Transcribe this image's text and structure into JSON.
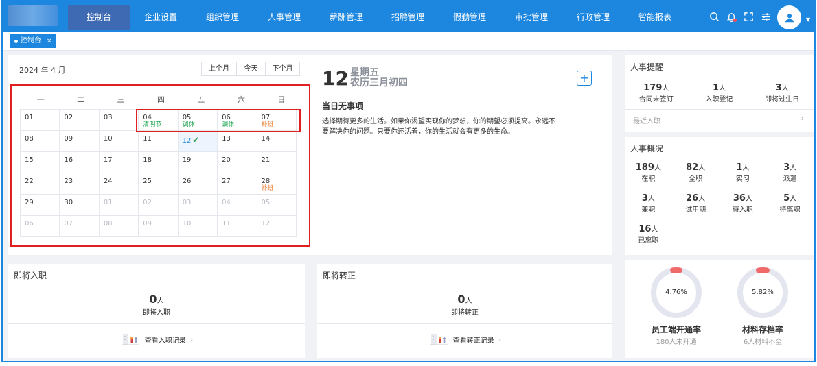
{
  "nav": {
    "items": [
      "控制台",
      "企业设置",
      "组织管理",
      "人事管理",
      "薪酬管理",
      "招聘管理",
      "假勤管理",
      "审批管理",
      "行政管理",
      "智能报表"
    ],
    "active_index": 0
  },
  "tabs": [
    {
      "label": "控制台",
      "close": "×"
    }
  ],
  "calendar": {
    "month_label": "2024 年 4 月",
    "buttons": [
      "上个月",
      "今天",
      "下个月"
    ],
    "weekdays": [
      "一",
      "二",
      "三",
      "四",
      "五",
      "六",
      "日"
    ],
    "weeks": [
      [
        {
          "d": "01"
        },
        {
          "d": "02"
        },
        {
          "d": "03"
        },
        {
          "d": "04",
          "sub": "清明节",
          "c": "green"
        },
        {
          "d": "05",
          "sub": "调休",
          "c": "green"
        },
        {
          "d": "06",
          "sub": "调休",
          "c": "green"
        },
        {
          "d": "07",
          "sub": "补班",
          "c": "orange"
        }
      ],
      [
        {
          "d": "08"
        },
        {
          "d": "09"
        },
        {
          "d": "10"
        },
        {
          "d": "11"
        },
        {
          "d": "12",
          "today": true
        },
        {
          "d": "13"
        },
        {
          "d": "14"
        }
      ],
      [
        {
          "d": "15"
        },
        {
          "d": "16"
        },
        {
          "d": "17"
        },
        {
          "d": "18"
        },
        {
          "d": "19"
        },
        {
          "d": "20"
        },
        {
          "d": "21"
        }
      ],
      [
        {
          "d": "22"
        },
        {
          "d": "23"
        },
        {
          "d": "24"
        },
        {
          "d": "25"
        },
        {
          "d": "26"
        },
        {
          "d": "27"
        },
        {
          "d": "28",
          "sub": "补班",
          "c": "orange"
        }
      ],
      [
        {
          "d": "29"
        },
        {
          "d": "30"
        },
        {
          "d": "01",
          "dim": true
        },
        {
          "d": "02",
          "dim": true
        },
        {
          "d": "03",
          "dim": true
        },
        {
          "d": "04",
          "dim": true
        },
        {
          "d": "05",
          "dim": true
        }
      ],
      [
        {
          "d": "06",
          "dim": true
        },
        {
          "d": "07",
          "dim": true
        },
        {
          "d": "08",
          "dim": true
        },
        {
          "d": "09",
          "dim": true
        },
        {
          "d": "10",
          "dim": true
        },
        {
          "d": "11",
          "dim": true
        },
        {
          "d": "12",
          "dim": true
        }
      ]
    ]
  },
  "day_detail": {
    "day": "12",
    "weekday": "星期五",
    "lunar": "农历三月初四",
    "add": "+",
    "no_event": "当日无事项",
    "quote": "选择期待更多的生活。如果你渴望实现你的梦想，你的期望必须提高。永远不要解决你的问题。只要你还活着，你的生活就会有更多的生命。"
  },
  "reminder": {
    "title": "人事提醒",
    "stats": [
      {
        "value": "179",
        "unit": "人",
        "label": "合同未签订"
      },
      {
        "value": "1",
        "unit": "人",
        "label": "入职登记"
      },
      {
        "value": "3",
        "unit": "人",
        "label": "即将过生日"
      }
    ],
    "recent": "最近入职",
    "arrow": "›"
  },
  "overview": {
    "title": "人事概况",
    "items": [
      {
        "value": "189",
        "unit": "人",
        "label": "在职"
      },
      {
        "value": "82",
        "unit": "人",
        "label": "全职"
      },
      {
        "value": "1",
        "unit": "人",
        "label": "实习"
      },
      {
        "value": "3",
        "unit": "人",
        "label": "派遣"
      },
      {
        "value": "3",
        "unit": "人",
        "label": "兼职"
      },
      {
        "value": "26",
        "unit": "人",
        "label": "试用期"
      },
      {
        "value": "36",
        "unit": "人",
        "label": "待入职"
      },
      {
        "value": "5",
        "unit": "人",
        "label": "待离职"
      },
      {
        "value": "16",
        "unit": "人",
        "label": "已离职"
      }
    ]
  },
  "join": {
    "title": "即将入职",
    "count": "0",
    "unit": "人",
    "label": "即将入职",
    "link": "查看入职记录",
    "arrow": "›"
  },
  "regular": {
    "title": "即将转正",
    "count": "0",
    "unit": "人",
    "label": "即将转正",
    "link": "查看转正记录",
    "arrow": "›"
  },
  "rates": [
    {
      "percent_text": "4.76%",
      "percent": 4.76,
      "name": "员工端开通率",
      "sub": "180人未开通"
    },
    {
      "percent_text": "5.82%",
      "percent": 5.82,
      "name": "材料存档率",
      "sub": "6人材料不全"
    }
  ],
  "colors": {
    "primary": "#1d87e0",
    "nav_active": "#3e6ab3",
    "holiday": "#17a34a",
    "workday": "#f07a2a",
    "ring_track": "#e3e6ef",
    "ring_fill": "#f06a6a",
    "highlight_box": "#e02020"
  }
}
